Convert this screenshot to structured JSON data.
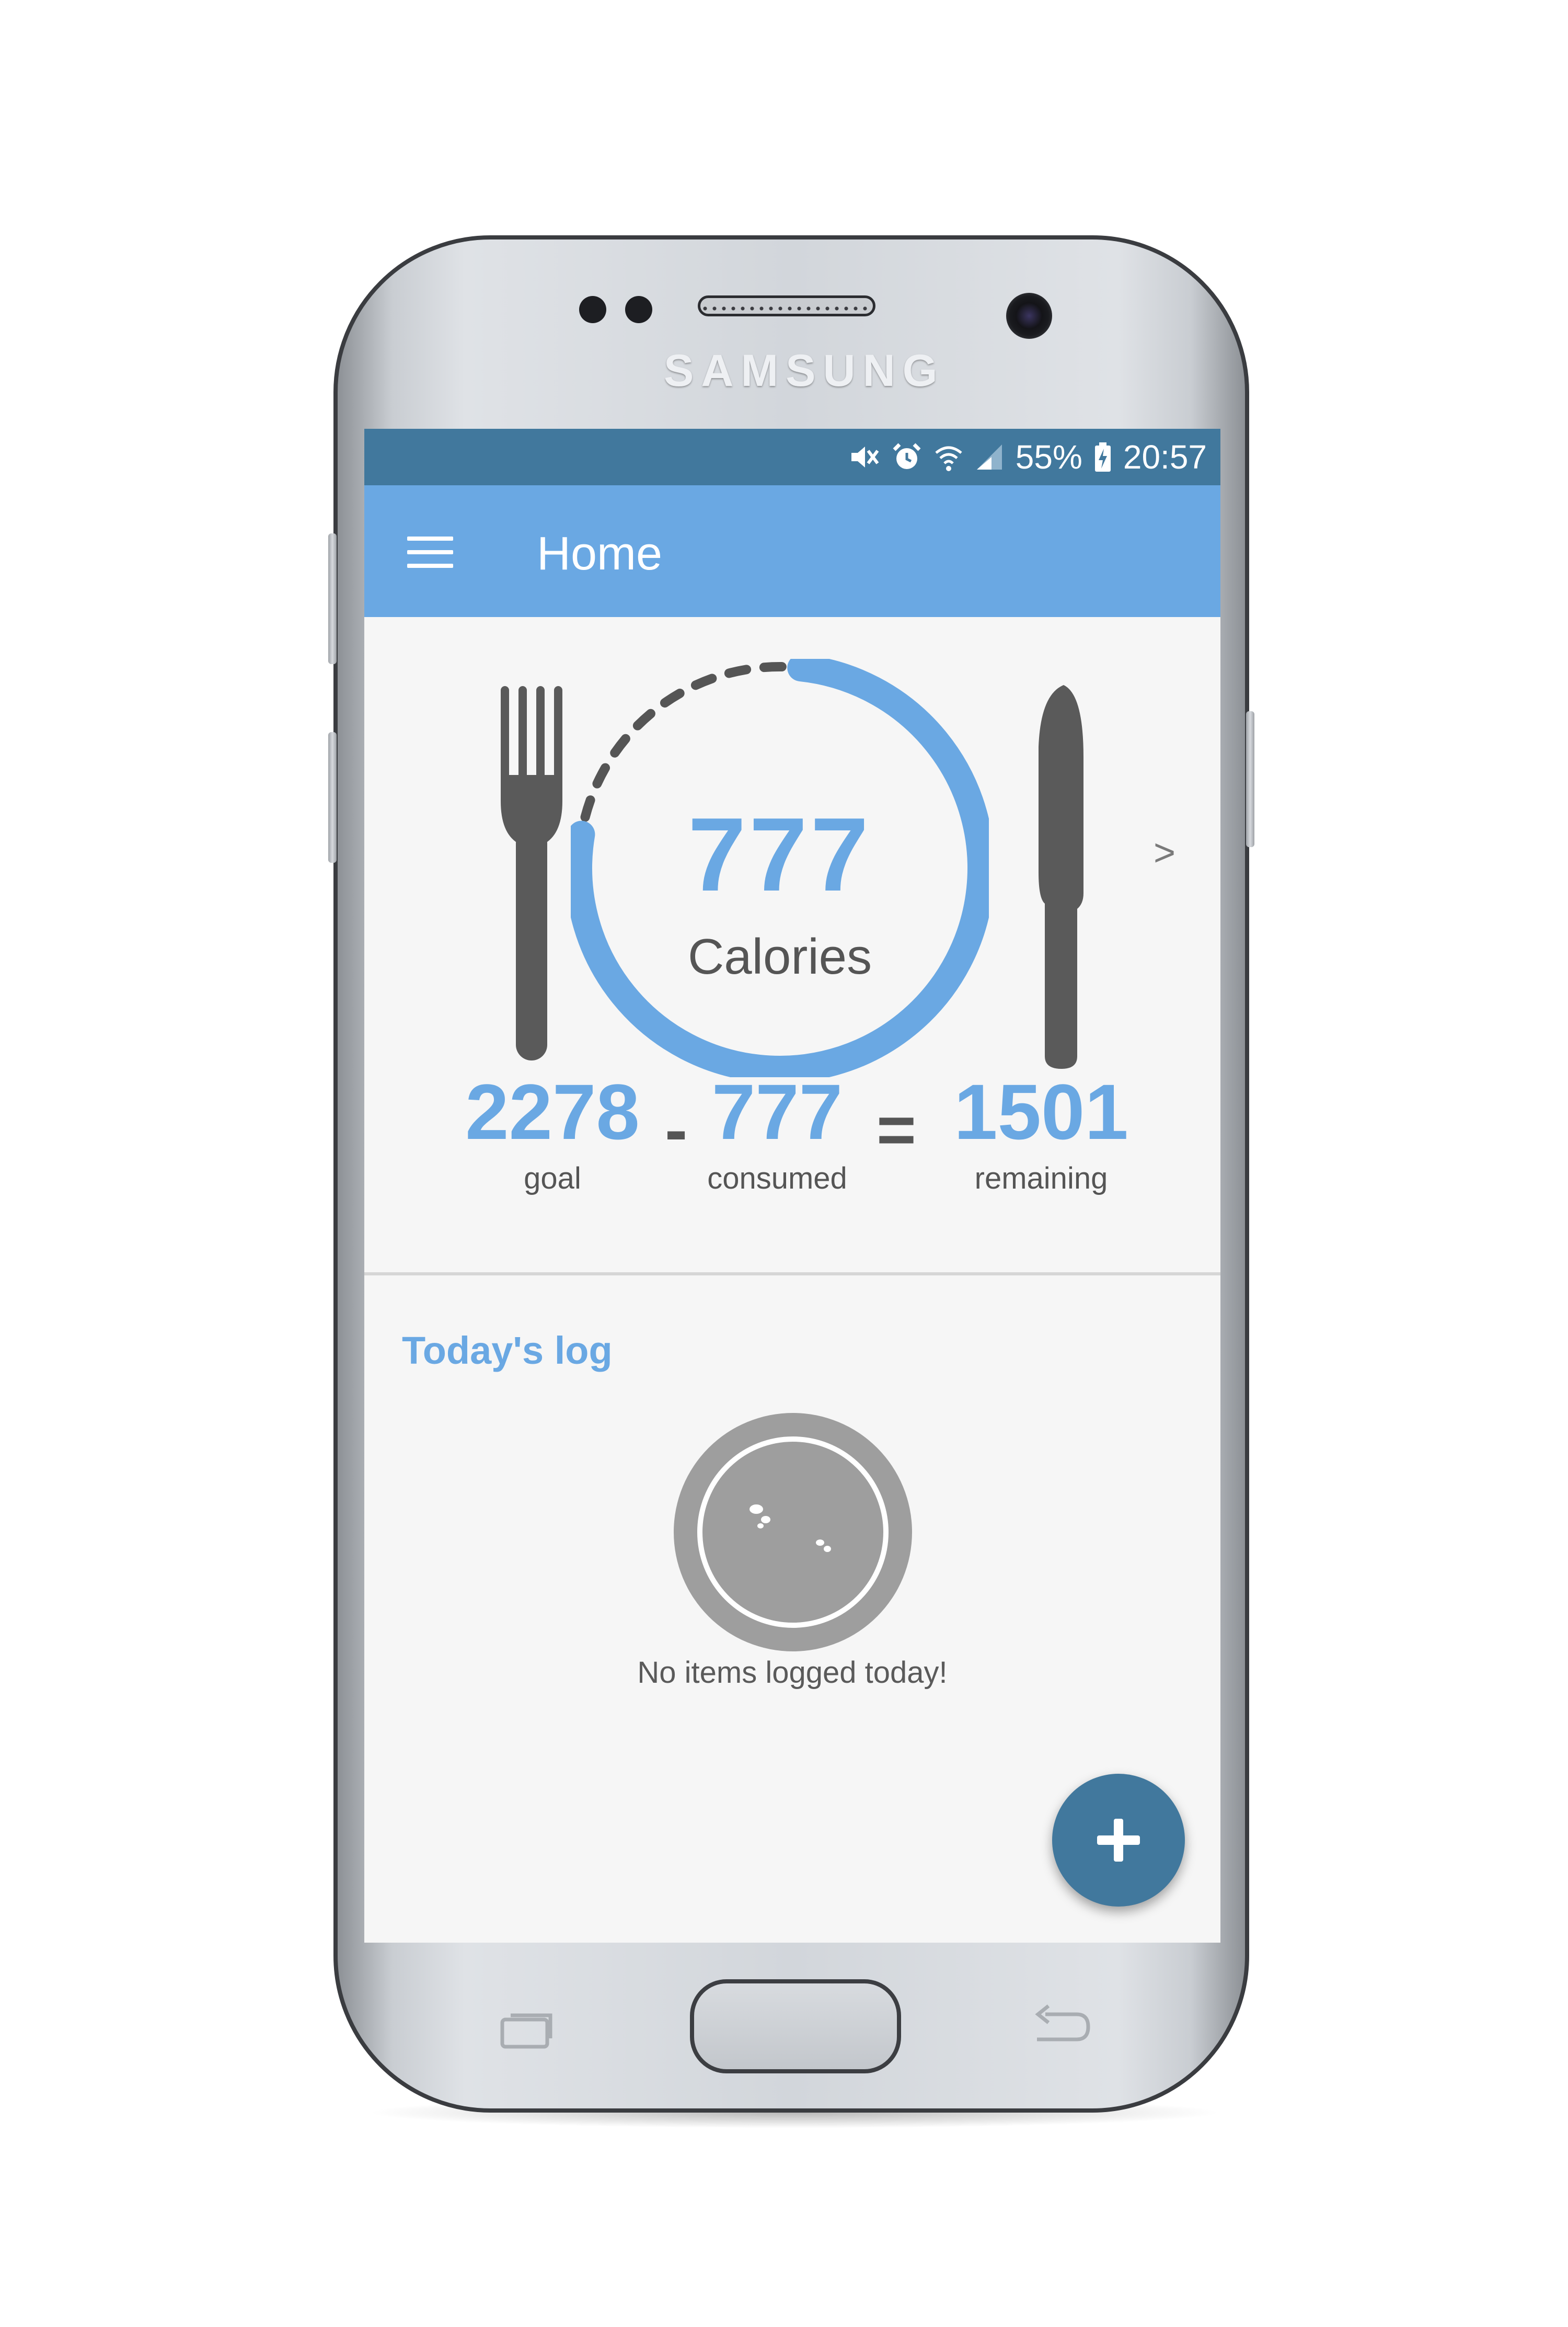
{
  "device": {
    "brand": "SAMSUNG"
  },
  "status_bar": {
    "battery": "55%",
    "time": "20:57"
  },
  "app_bar": {
    "title": "Home"
  },
  "summary": {
    "calories_value": "777",
    "calories_label": "Calories",
    "consumed_fraction": 0.76,
    "next_label": ">"
  },
  "equation": {
    "goal_value": "2278",
    "goal_label": "goal",
    "minus": "-",
    "consumed_value": "777",
    "consumed_label": "consumed",
    "equals": "=",
    "remaining_value": "1501",
    "remaining_label": "remaining"
  },
  "log": {
    "title": "Today's log",
    "empty_message": "No items logged today!"
  },
  "colors": {
    "primary": "#6aa8e3",
    "dark_primary": "#41789d",
    "background": "#f6f6f6",
    "text_gray": "#555555"
  },
  "icons": {
    "menu": "hamburger-icon",
    "add": "plus-icon",
    "fork": "fork-icon",
    "knife": "knife-icon",
    "plate": "empty-plate-icon"
  }
}
